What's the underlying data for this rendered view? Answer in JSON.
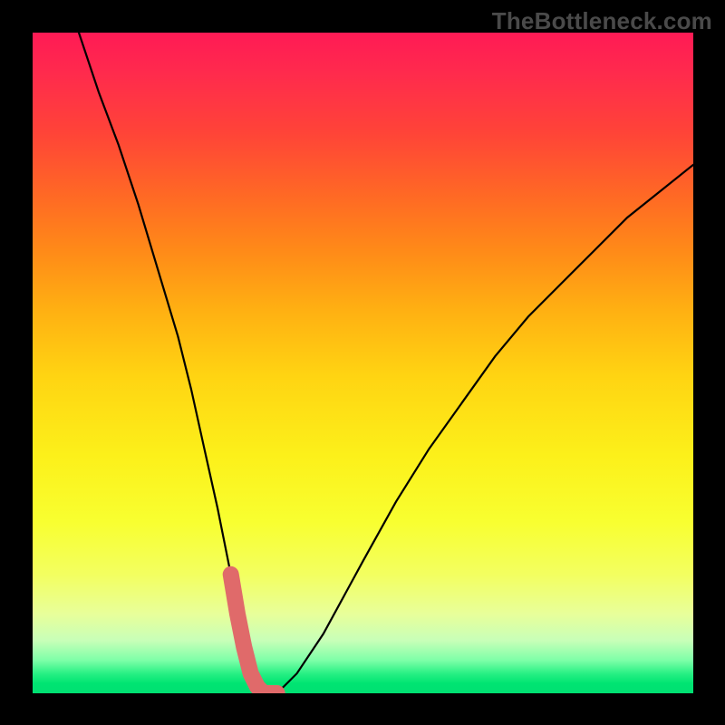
{
  "watermark": "TheBottleneck.com",
  "chart_data": {
    "type": "line",
    "title": "",
    "xlabel": "",
    "ylabel": "",
    "xlim": [
      0,
      100
    ],
    "ylim": [
      0,
      100
    ],
    "series": [
      {
        "name": "bottleneck-curve",
        "x": [
          7,
          10,
          13,
          16,
          19,
          22,
          24,
          26,
          28,
          30,
          31,
          32,
          33,
          34,
          35,
          37,
          40,
          44,
          50,
          55,
          60,
          65,
          70,
          75,
          80,
          85,
          90,
          95,
          100
        ],
        "y": [
          100,
          91,
          83,
          74,
          64,
          54,
          46,
          37,
          28,
          18,
          12,
          7,
          3,
          1,
          0,
          0,
          3,
          9,
          20,
          29,
          37,
          44,
          51,
          57,
          62,
          67,
          72,
          76,
          80
        ]
      }
    ],
    "annotations": [
      {
        "name": "valley-marker",
        "x_range": [
          30,
          37
        ],
        "style": "thick-pink-segment"
      }
    ],
    "background": {
      "type": "vertical-gradient",
      "stops": [
        {
          "pos": 0,
          "color": "#ff1a55"
        },
        {
          "pos": 50,
          "color": "#ffd412"
        },
        {
          "pos": 100,
          "color": "#00e072"
        }
      ]
    }
  }
}
